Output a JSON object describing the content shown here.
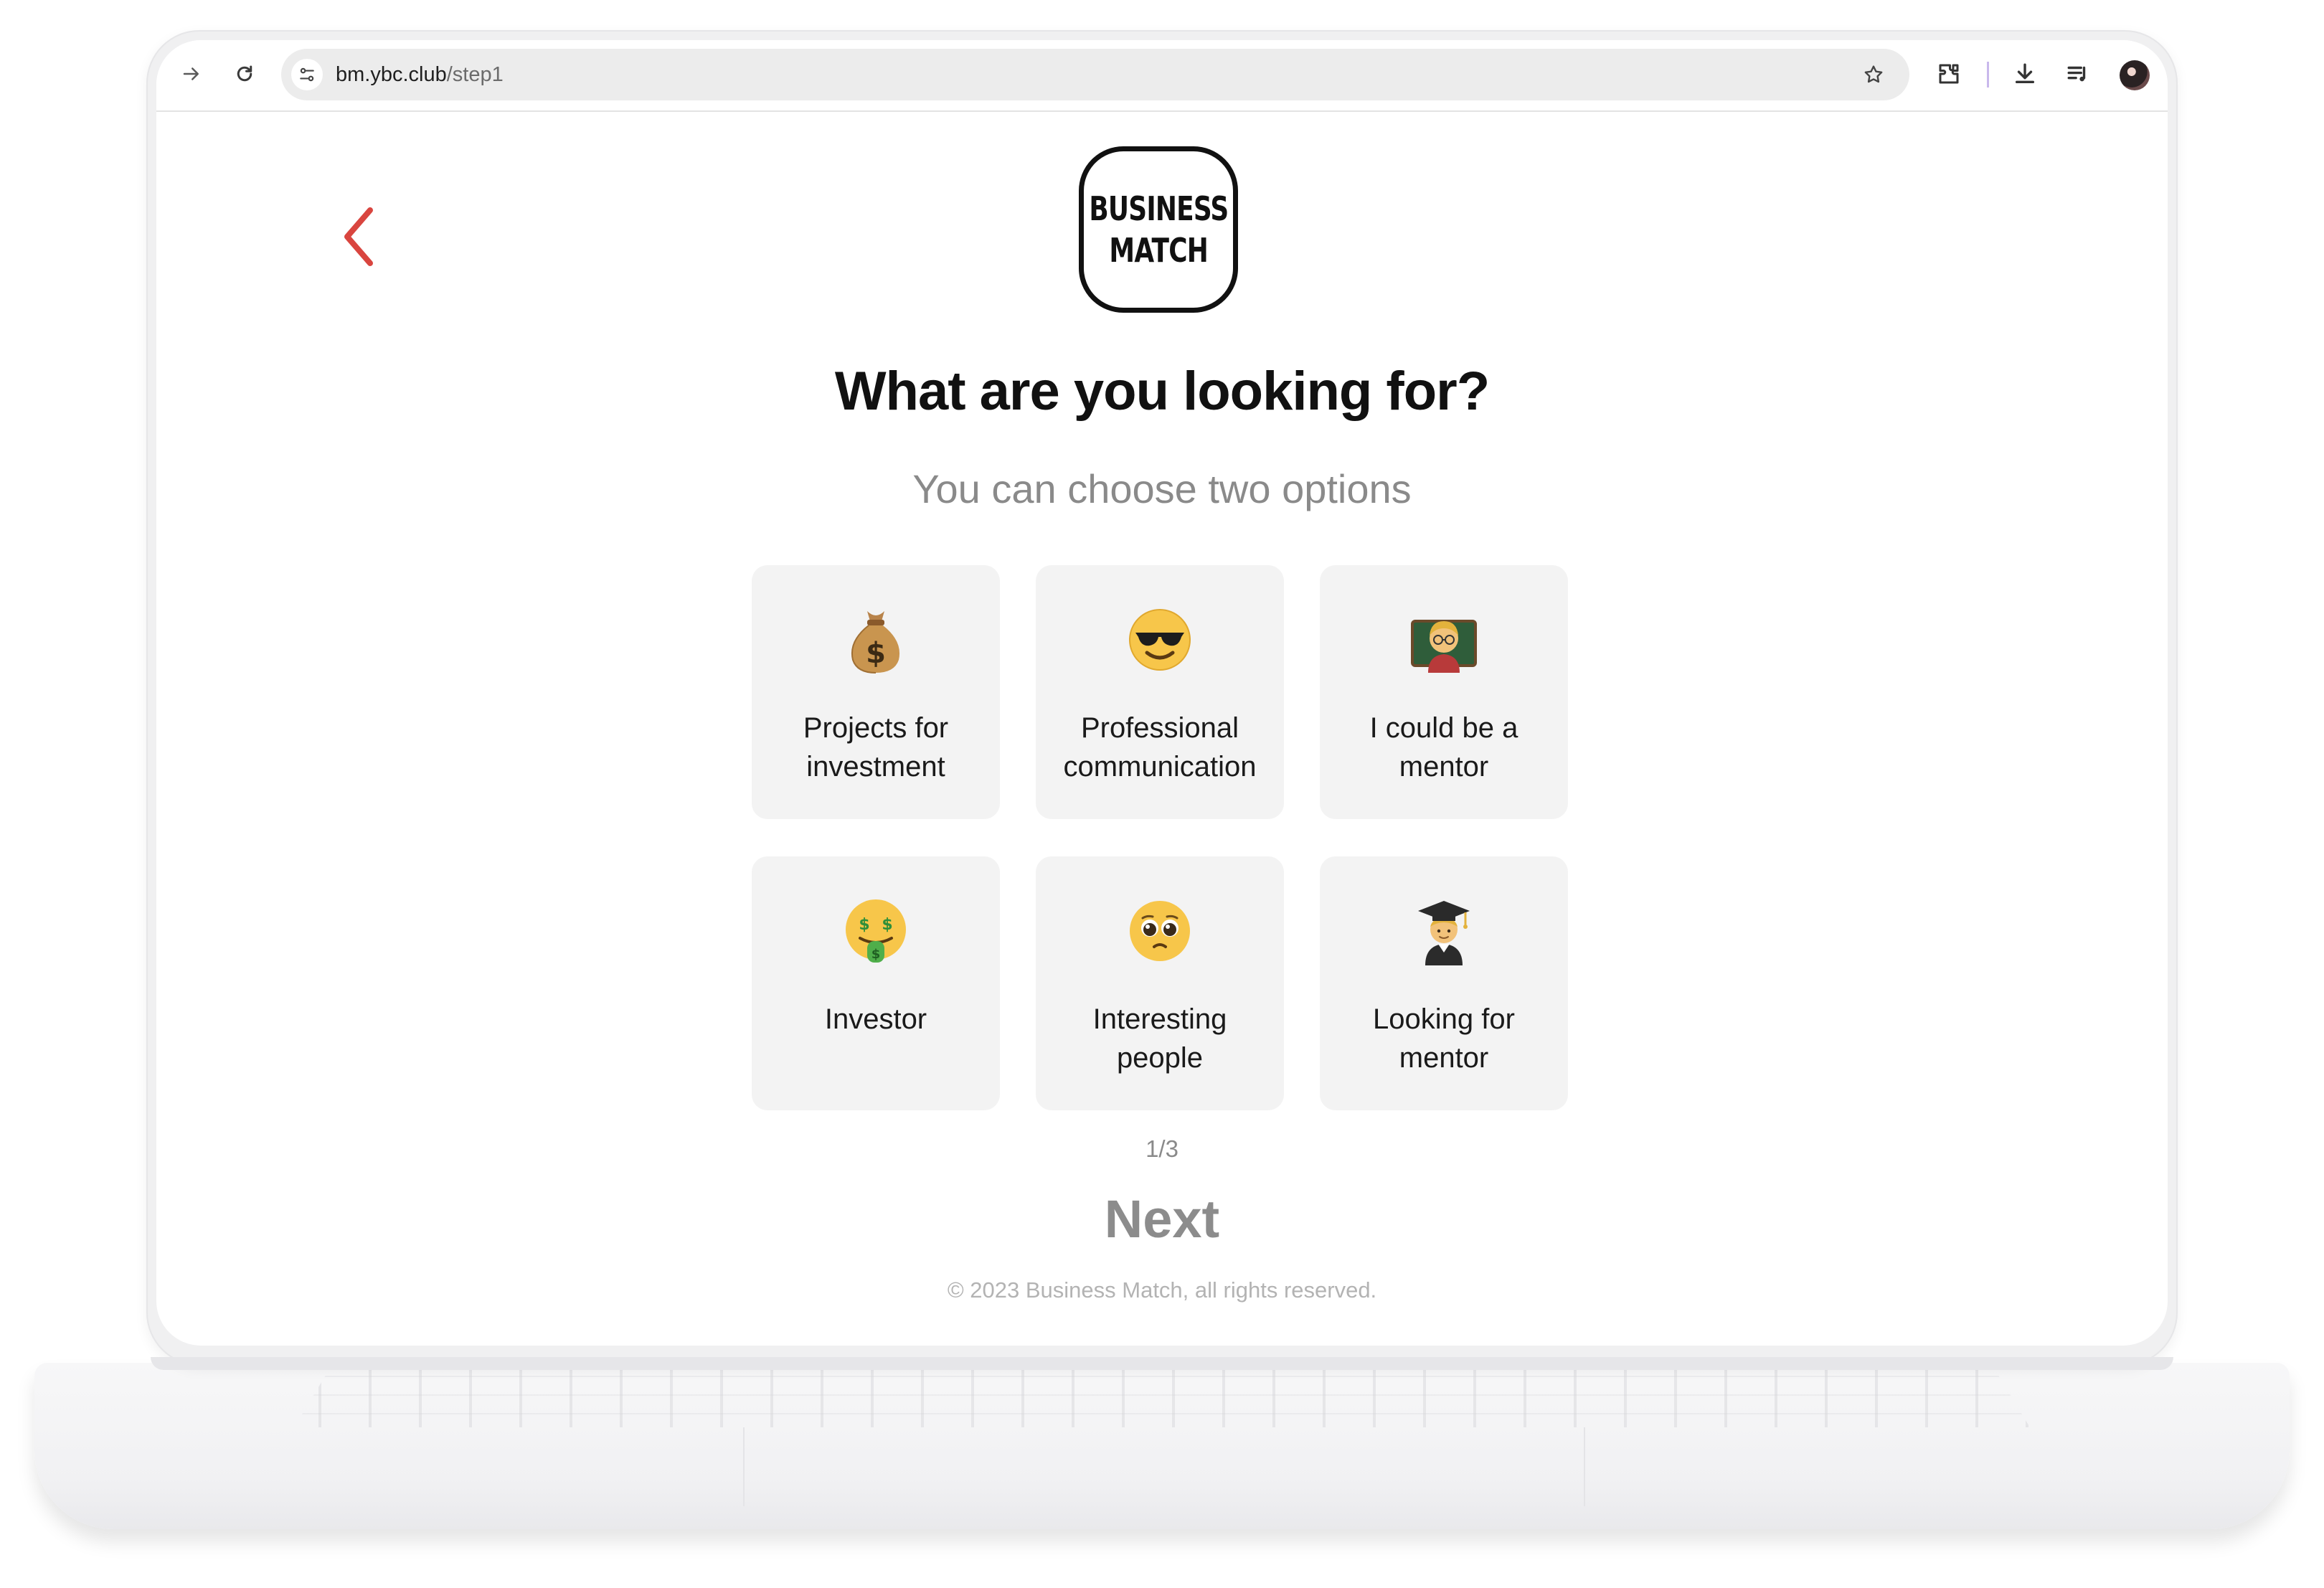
{
  "browser": {
    "url_domain": "bm.ybc.club",
    "url_path": "/step1",
    "icons": [
      "forward-icon",
      "reload-icon",
      "site-settings-icon",
      "bookmark-star-icon",
      "extensions-icon",
      "downloads-icon",
      "reading-list-icon",
      "profile-avatar"
    ]
  },
  "logo": {
    "line1": "BUSINESS",
    "line2": "MATCH"
  },
  "page": {
    "heading": "What are you looking for?",
    "subheading": "You can choose two options",
    "step": "1/3",
    "next_label": "Next",
    "footer": "© 2023 Business Match, all rights reserved."
  },
  "options": [
    {
      "label_line1": "Projects for",
      "label_line2": "investment",
      "emoji": "money-bag"
    },
    {
      "label_line1": "Professional",
      "label_line2": "communication",
      "emoji": "smiling-face-with-sunglasses"
    },
    {
      "label_line1": "I could be a",
      "label_line2": "mentor",
      "emoji": "teacher"
    },
    {
      "label_line1": "Investor",
      "label_line2": "",
      "emoji": "money-mouth-face"
    },
    {
      "label_line1": "Interesting",
      "label_line2": "people",
      "emoji": "pleading-face"
    },
    {
      "label_line1": "Looking for",
      "label_line2": "mentor",
      "emoji": "student"
    }
  ],
  "colors": {
    "back_arrow": "#d9453f",
    "card_bg": "#f3f3f3",
    "heading": "#111111",
    "muted": "#8a8a8a"
  }
}
